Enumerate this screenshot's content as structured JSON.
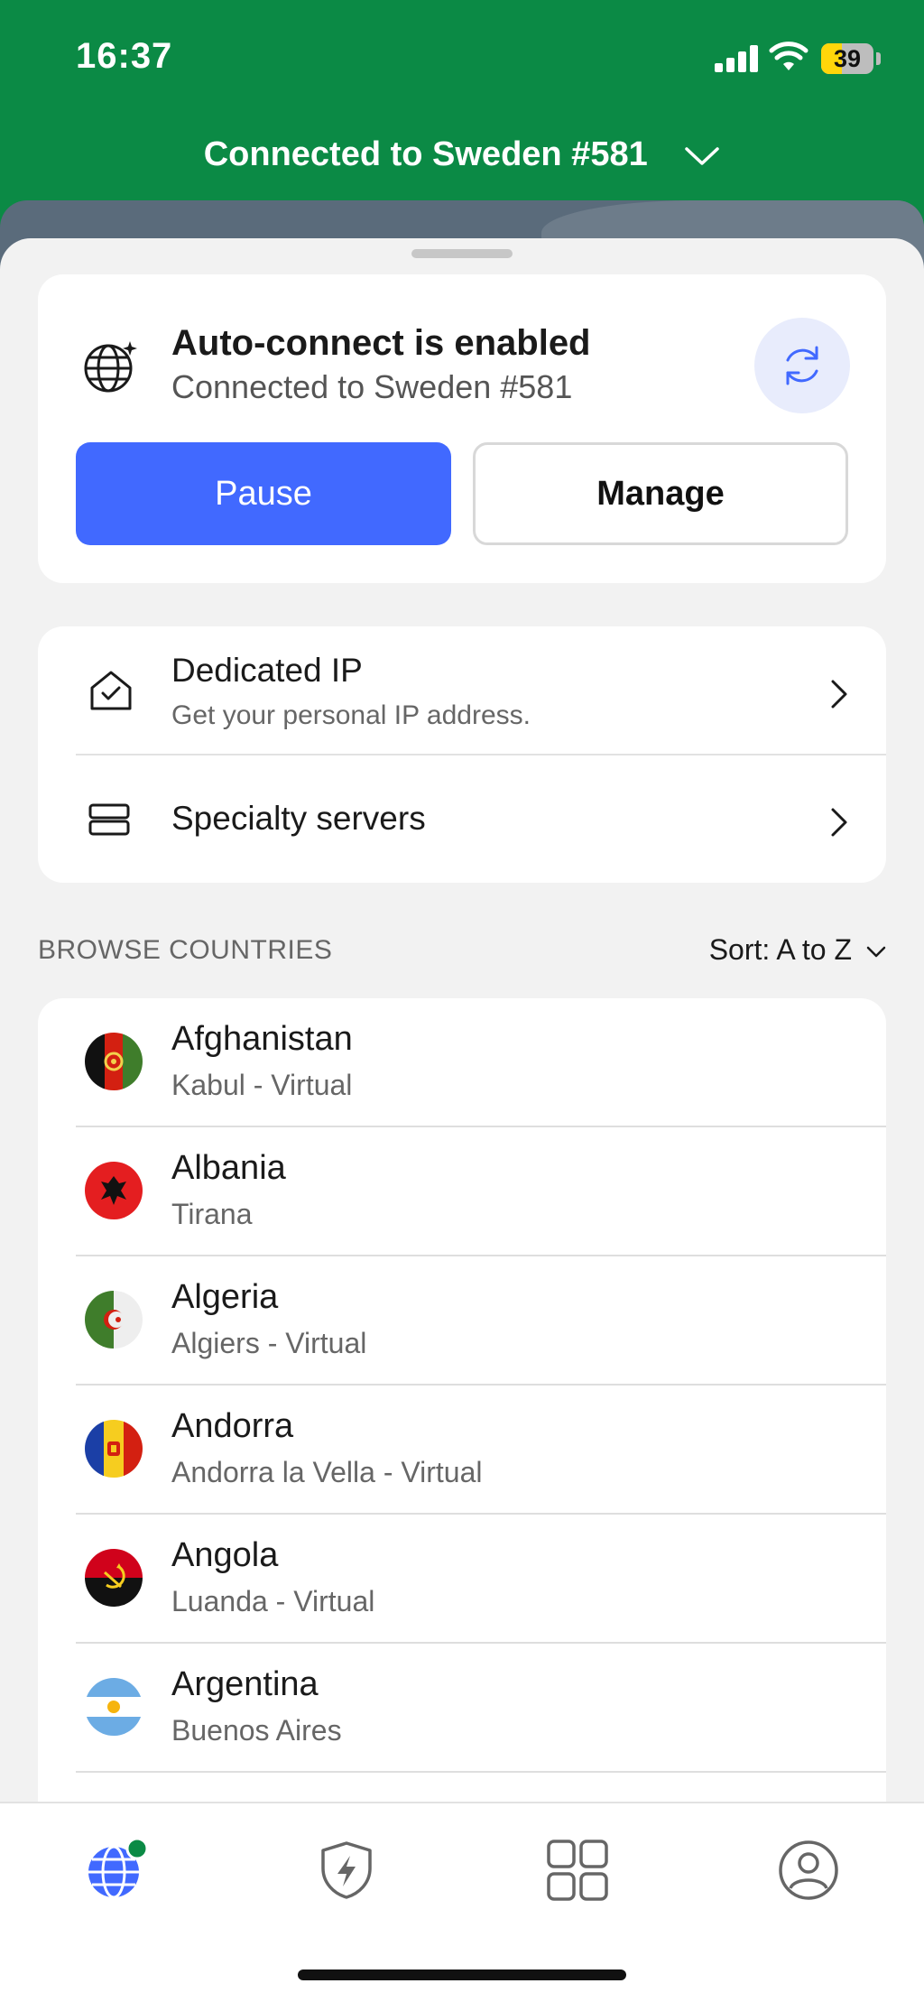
{
  "status": {
    "time": "16:37",
    "battery": "39",
    "battery_level": 0.39
  },
  "header": {
    "title": "Connected to Sweden #581",
    "chevron_icon": "chevron-down-icon"
  },
  "autoconnect": {
    "title": "Auto-connect is enabled",
    "subtitle": "Connected to Sweden #581",
    "pause_label": "Pause",
    "manage_label": "Manage"
  },
  "options": [
    {
      "title": "Dedicated IP",
      "subtitle": "Get your personal IP address.",
      "icon": "house-check-icon"
    },
    {
      "title": "Specialty servers",
      "subtitle": "",
      "icon": "servers-icon"
    }
  ],
  "browse": {
    "label": "BROWSE COUNTRIES",
    "sort_label": "Sort: A to Z"
  },
  "countries": [
    {
      "name": "Afghanistan",
      "city": "Kabul - Virtual"
    },
    {
      "name": "Albania",
      "city": "Tirana"
    },
    {
      "name": "Algeria",
      "city": "Algiers - Virtual"
    },
    {
      "name": "Andorra",
      "city": "Andorra la Vella - Virtual"
    },
    {
      "name": "Angola",
      "city": "Luanda - Virtual"
    },
    {
      "name": "Argentina",
      "city": "Buenos Aires"
    }
  ],
  "tabs": [
    "globe-icon",
    "shield-bolt-icon",
    "grid-icon",
    "profile-icon"
  ],
  "colors": {
    "brand_green": "#0b8a45",
    "accent_blue": "#4169ff",
    "connected_dot": "#0b8a45"
  }
}
